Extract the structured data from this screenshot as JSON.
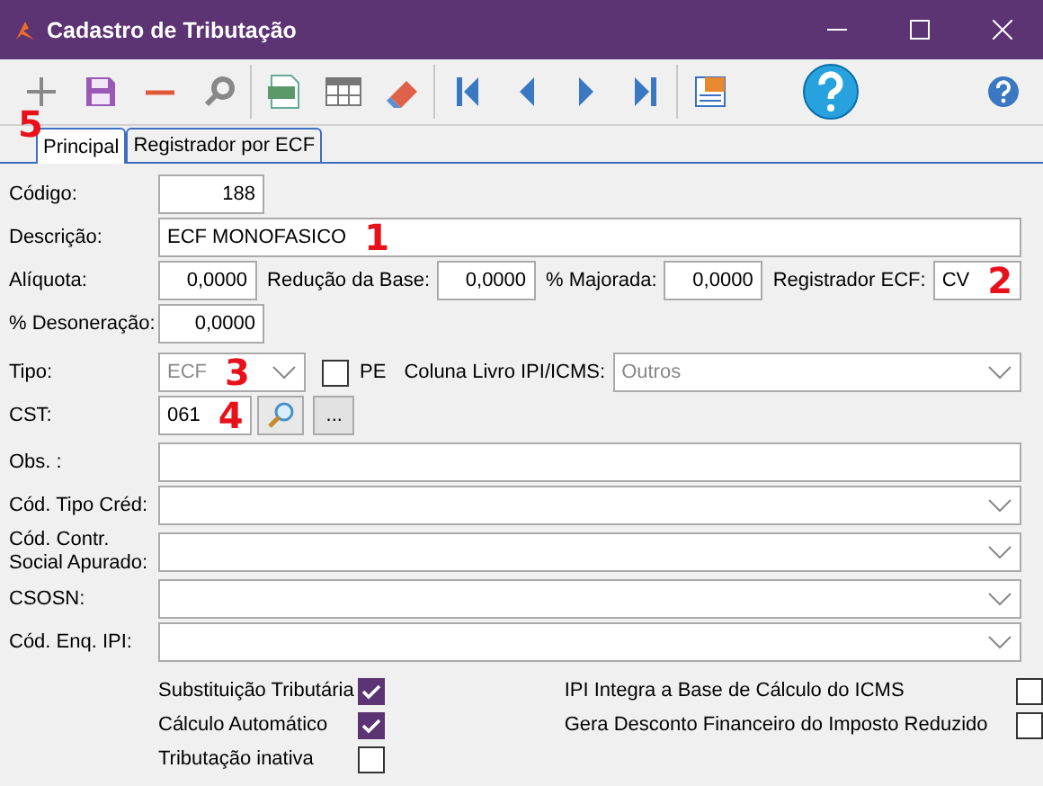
{
  "window": {
    "title": "Cadastro de Tributação"
  },
  "toolbar": [
    {
      "kind": "add",
      "marker": "5"
    },
    {
      "kind": "save"
    },
    {
      "kind": "remove"
    },
    {
      "kind": "find"
    },
    {
      "kind": "separator"
    },
    {
      "kind": "txt"
    },
    {
      "kind": "grid"
    },
    {
      "kind": "eraser"
    },
    {
      "kind": "separator"
    },
    {
      "kind": "first"
    },
    {
      "kind": "prev"
    },
    {
      "kind": "next"
    },
    {
      "kind": "last"
    },
    {
      "kind": "separator"
    },
    {
      "kind": "log"
    },
    {
      "kind": "help-large"
    },
    {
      "kind": "help"
    }
  ],
  "tabs": [
    {
      "label": "Principal",
      "selected": true
    },
    {
      "label": "Registrador por ECF",
      "selected": false
    }
  ],
  "form": {
    "codigo": {
      "label": "Código:",
      "value": "188"
    },
    "descricao": {
      "label": "Descrição:",
      "value": "ECF MONOFASICO",
      "marker": "1"
    },
    "aliquota": {
      "label": "Alíquota:",
      "value": "0,0000"
    },
    "reducao": {
      "label": "Redução da Base:",
      "value": "0,0000"
    },
    "majorada": {
      "label": "% Majorada:",
      "value": "0,0000"
    },
    "registrador": {
      "label": "Registrador ECF:",
      "value": "CV",
      "marker": "2"
    },
    "desoneracao": {
      "label": "% Desoneração:",
      "value": "0,0000"
    },
    "tipo": {
      "label": "Tipo:",
      "value": "ECF",
      "disabled": true,
      "marker": "3"
    },
    "pe": {
      "label": "PE",
      "checked": false
    },
    "coluna": {
      "label": "Coluna Livro IPI/ICMS:",
      "value": "Outros",
      "disabled": true
    },
    "cst": {
      "label": "CST:",
      "value": "061",
      "marker": "4",
      "more": "..."
    },
    "obs": {
      "label": "Obs. :"
    },
    "dropdowns": [
      {
        "label": "Cód. Tipo Créd:"
      },
      {
        "label": "Cód. Contr.\nSocial Apurado:"
      },
      {
        "label": "CSOSN:"
      },
      {
        "label": "Cód. Enq. IPI:"
      }
    ]
  },
  "checks_left": [
    {
      "label": "Substituição Tributária",
      "checked": true
    },
    {
      "label": "Cálculo Automático",
      "checked": true
    },
    {
      "label": "Tributação inativa",
      "checked": false
    }
  ],
  "checks_right": [
    {
      "label": "IPI Integra a Base de Cálculo do ICMS",
      "checked": false
    },
    {
      "label": "Gera Desconto Financeiro do Imposto Reduzido",
      "checked": false
    }
  ]
}
